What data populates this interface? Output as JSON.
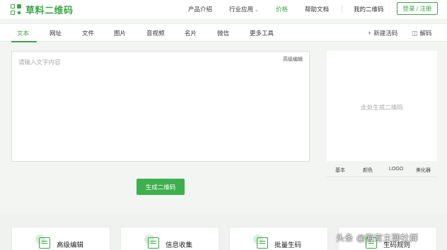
{
  "header": {
    "logo_text": "草料二维码",
    "nav": {
      "products": "产品介绍",
      "industry": "行业应用",
      "price": "价格",
      "help": "帮助文档",
      "my_codes": "我的二维码"
    },
    "login_label": "登录 / 注册"
  },
  "tabs": [
    "文本",
    "网址",
    "文件",
    "图片",
    "音视频",
    "名片",
    "微信",
    "更多工具"
  ],
  "toolbar": {
    "new_live_code": "新建活码",
    "decode": "解码"
  },
  "editor": {
    "placeholder": "请输入文字内容",
    "advanced_label": "高级编辑"
  },
  "generate_label": "生成二维码",
  "preview": {
    "placeholder": "此处生成二维码",
    "tabs": [
      "基本",
      "颜色",
      "LOGO",
      "美化器"
    ]
  },
  "features": [
    "高级编辑",
    "信息收集",
    "批量生码",
    "生码规则"
  ],
  "watermark": "头条 @海宫主聊社群",
  "colors": {
    "accent": "#3da64a",
    "button": "#3cb04c",
    "background": "#f3f5f3"
  }
}
